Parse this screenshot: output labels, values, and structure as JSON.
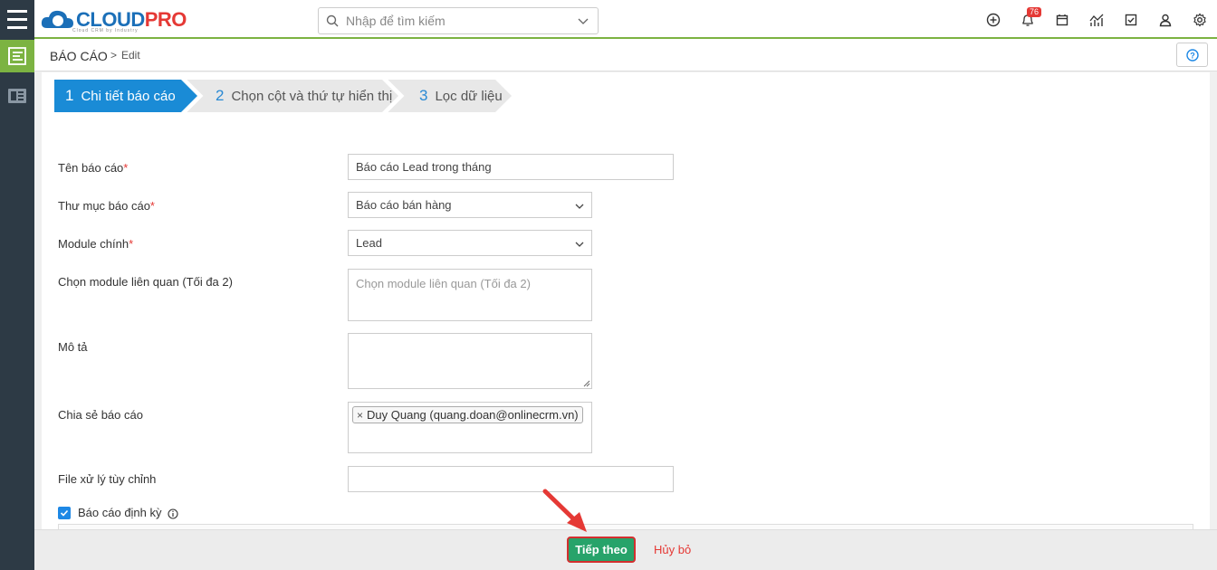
{
  "header": {
    "logo_text_a": "CLOUD",
    "logo_text_b": "PRO",
    "logo_sub": "Cloud CRM by Industry",
    "search_placeholder": "Nhập để tìm kiếm",
    "notification_count": "76"
  },
  "breadcrumb": {
    "title": "BÁO CÁO",
    "separator": ">",
    "current": "Edit"
  },
  "steps": [
    {
      "num": "1",
      "label": "Chi tiết báo cáo",
      "active": true
    },
    {
      "num": "2",
      "label": "Chọn cột và thứ tự hiển thị",
      "active": false
    },
    {
      "num": "3",
      "label": "Lọc dữ liệu",
      "active": false
    }
  ],
  "form": {
    "report_name": {
      "label": "Tên báo cáo",
      "required": "*",
      "value": "Báo cáo Lead trong tháng"
    },
    "report_folder": {
      "label": "Thư mục báo cáo",
      "required": "*",
      "value": "Báo cáo bán hàng"
    },
    "main_module": {
      "label": "Module chính",
      "required": "*",
      "value": "Lead"
    },
    "related_modules": {
      "label": "Chọn module liên quan (Tối đa 2)",
      "placeholder": "Chọn module liên quan (Tối đa 2)"
    },
    "description": {
      "label": "Mô tả",
      "value": ""
    },
    "share": {
      "label": "Chia sẻ báo cáo",
      "tag_remove": "×",
      "tag": "Duy Quang (quang.doan@onlinecrm.vn)"
    },
    "custom_file": {
      "label": "File xử lý tùy chỉnh",
      "value": ""
    },
    "periodic": {
      "label": "Báo cáo định kỳ",
      "checked": true
    }
  },
  "footer": {
    "next_label": "Tiếp theo",
    "cancel_label": "Hủy bỏ"
  },
  "colors": {
    "accent_green": "#7cb342",
    "step_active": "#1a8bd6",
    "btn_next": "#27a36a",
    "highlight_red": "#d32f2f",
    "sidebar": "#2d3a45"
  }
}
